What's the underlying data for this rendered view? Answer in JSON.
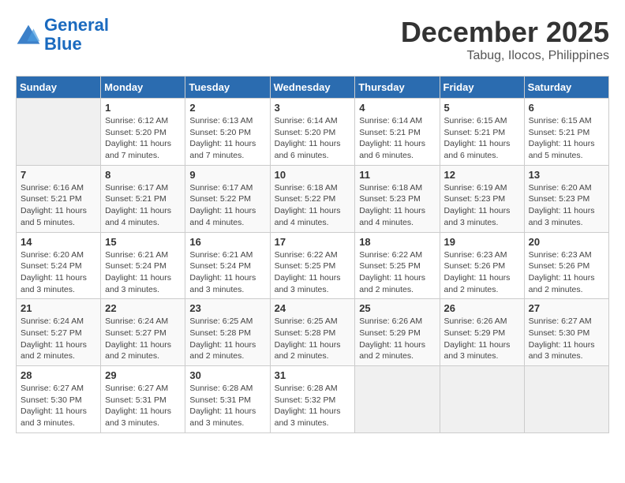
{
  "header": {
    "logo_line1": "General",
    "logo_line2": "Blue",
    "month": "December 2025",
    "location": "Tabug, Ilocos, Philippines"
  },
  "days_of_week": [
    "Sunday",
    "Monday",
    "Tuesday",
    "Wednesday",
    "Thursday",
    "Friday",
    "Saturday"
  ],
  "weeks": [
    [
      {
        "day": "",
        "info": ""
      },
      {
        "day": "1",
        "info": "Sunrise: 6:12 AM\nSunset: 5:20 PM\nDaylight: 11 hours\nand 7 minutes."
      },
      {
        "day": "2",
        "info": "Sunrise: 6:13 AM\nSunset: 5:20 PM\nDaylight: 11 hours\nand 7 minutes."
      },
      {
        "day": "3",
        "info": "Sunrise: 6:14 AM\nSunset: 5:20 PM\nDaylight: 11 hours\nand 6 minutes."
      },
      {
        "day": "4",
        "info": "Sunrise: 6:14 AM\nSunset: 5:21 PM\nDaylight: 11 hours\nand 6 minutes."
      },
      {
        "day": "5",
        "info": "Sunrise: 6:15 AM\nSunset: 5:21 PM\nDaylight: 11 hours\nand 6 minutes."
      },
      {
        "day": "6",
        "info": "Sunrise: 6:15 AM\nSunset: 5:21 PM\nDaylight: 11 hours\nand 5 minutes."
      }
    ],
    [
      {
        "day": "7",
        "info": "Sunrise: 6:16 AM\nSunset: 5:21 PM\nDaylight: 11 hours\nand 5 minutes."
      },
      {
        "day": "8",
        "info": "Sunrise: 6:17 AM\nSunset: 5:21 PM\nDaylight: 11 hours\nand 4 minutes."
      },
      {
        "day": "9",
        "info": "Sunrise: 6:17 AM\nSunset: 5:22 PM\nDaylight: 11 hours\nand 4 minutes."
      },
      {
        "day": "10",
        "info": "Sunrise: 6:18 AM\nSunset: 5:22 PM\nDaylight: 11 hours\nand 4 minutes."
      },
      {
        "day": "11",
        "info": "Sunrise: 6:18 AM\nSunset: 5:23 PM\nDaylight: 11 hours\nand 4 minutes."
      },
      {
        "day": "12",
        "info": "Sunrise: 6:19 AM\nSunset: 5:23 PM\nDaylight: 11 hours\nand 3 minutes."
      },
      {
        "day": "13",
        "info": "Sunrise: 6:20 AM\nSunset: 5:23 PM\nDaylight: 11 hours\nand 3 minutes."
      }
    ],
    [
      {
        "day": "14",
        "info": "Sunrise: 6:20 AM\nSunset: 5:24 PM\nDaylight: 11 hours\nand 3 minutes."
      },
      {
        "day": "15",
        "info": "Sunrise: 6:21 AM\nSunset: 5:24 PM\nDaylight: 11 hours\nand 3 minutes."
      },
      {
        "day": "16",
        "info": "Sunrise: 6:21 AM\nSunset: 5:24 PM\nDaylight: 11 hours\nand 3 minutes."
      },
      {
        "day": "17",
        "info": "Sunrise: 6:22 AM\nSunset: 5:25 PM\nDaylight: 11 hours\nand 3 minutes."
      },
      {
        "day": "18",
        "info": "Sunrise: 6:22 AM\nSunset: 5:25 PM\nDaylight: 11 hours\nand 2 minutes."
      },
      {
        "day": "19",
        "info": "Sunrise: 6:23 AM\nSunset: 5:26 PM\nDaylight: 11 hours\nand 2 minutes."
      },
      {
        "day": "20",
        "info": "Sunrise: 6:23 AM\nSunset: 5:26 PM\nDaylight: 11 hours\nand 2 minutes."
      }
    ],
    [
      {
        "day": "21",
        "info": "Sunrise: 6:24 AM\nSunset: 5:27 PM\nDaylight: 11 hours\nand 2 minutes."
      },
      {
        "day": "22",
        "info": "Sunrise: 6:24 AM\nSunset: 5:27 PM\nDaylight: 11 hours\nand 2 minutes."
      },
      {
        "day": "23",
        "info": "Sunrise: 6:25 AM\nSunset: 5:28 PM\nDaylight: 11 hours\nand 2 minutes."
      },
      {
        "day": "24",
        "info": "Sunrise: 6:25 AM\nSunset: 5:28 PM\nDaylight: 11 hours\nand 2 minutes."
      },
      {
        "day": "25",
        "info": "Sunrise: 6:26 AM\nSunset: 5:29 PM\nDaylight: 11 hours\nand 2 minutes."
      },
      {
        "day": "26",
        "info": "Sunrise: 6:26 AM\nSunset: 5:29 PM\nDaylight: 11 hours\nand 3 minutes."
      },
      {
        "day": "27",
        "info": "Sunrise: 6:27 AM\nSunset: 5:30 PM\nDaylight: 11 hours\nand 3 minutes."
      }
    ],
    [
      {
        "day": "28",
        "info": "Sunrise: 6:27 AM\nSunset: 5:30 PM\nDaylight: 11 hours\nand 3 minutes."
      },
      {
        "day": "29",
        "info": "Sunrise: 6:27 AM\nSunset: 5:31 PM\nDaylight: 11 hours\nand 3 minutes."
      },
      {
        "day": "30",
        "info": "Sunrise: 6:28 AM\nSunset: 5:31 PM\nDaylight: 11 hours\nand 3 minutes."
      },
      {
        "day": "31",
        "info": "Sunrise: 6:28 AM\nSunset: 5:32 PM\nDaylight: 11 hours\nand 3 minutes."
      },
      {
        "day": "",
        "info": ""
      },
      {
        "day": "",
        "info": ""
      },
      {
        "day": "",
        "info": ""
      }
    ]
  ]
}
